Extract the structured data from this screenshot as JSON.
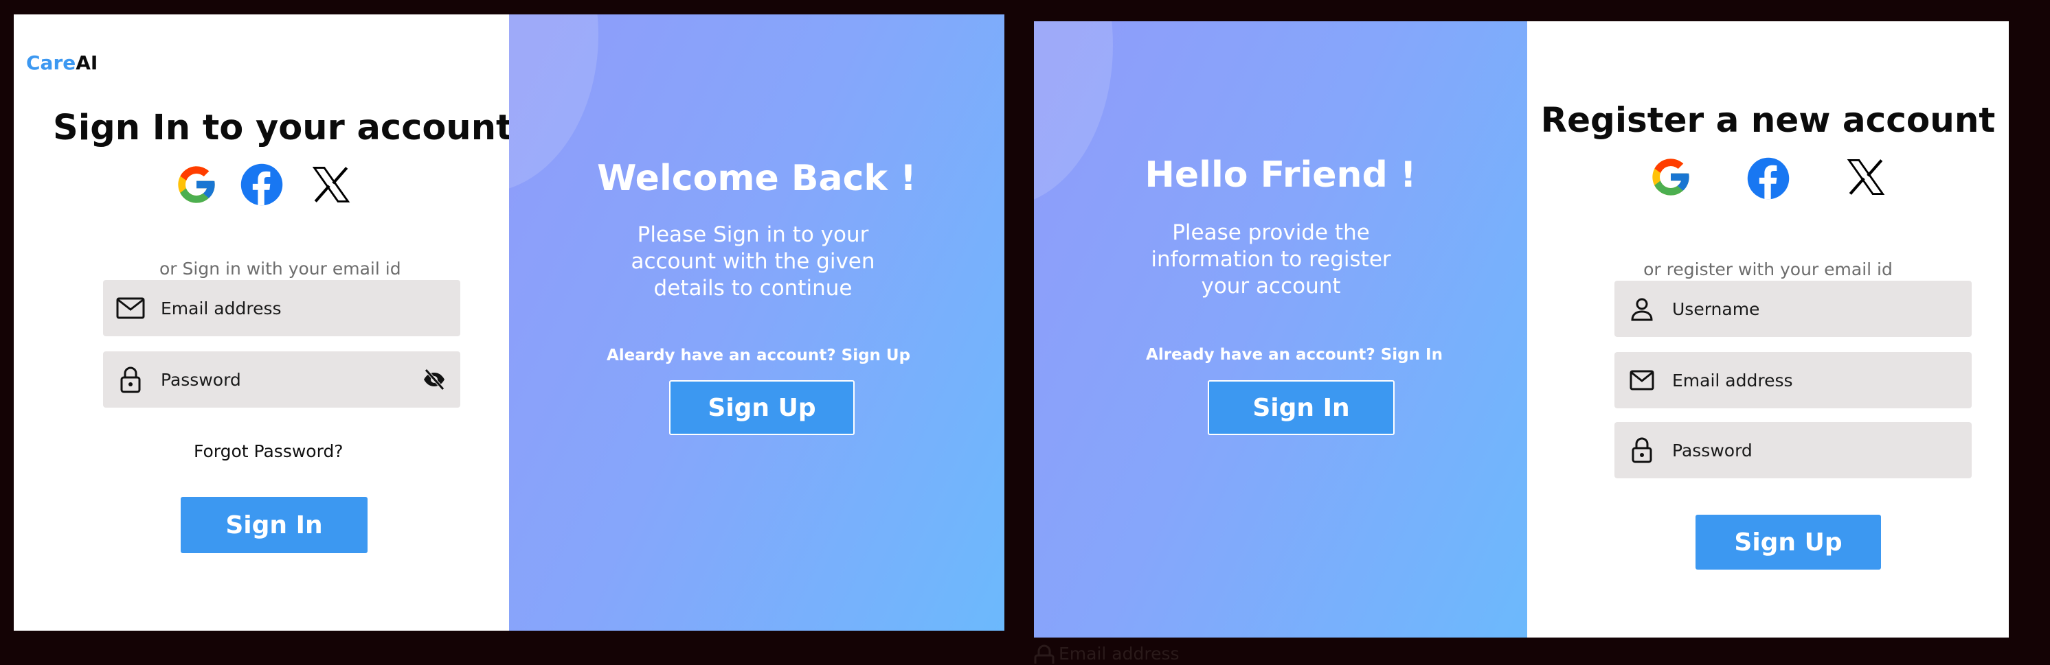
{
  "colors": {
    "background": "#140305",
    "brand_blue": "#3c98f1",
    "field_bg": "#e7e4e4",
    "gradient_start": "#8f9cf9",
    "gradient_end": "#6cb9fc"
  },
  "signin_form": {
    "logo_part1": "Care",
    "logo_part2": "AI",
    "title": "Sign In to your account",
    "social_icons": [
      "google-icon",
      "facebook-icon",
      "x-icon"
    ],
    "divider_text": "or Sign in with your email id",
    "email_placeholder": "Email address",
    "password_placeholder": "Password",
    "forgot_password": "Forgot Password?",
    "submit_label": "Sign In"
  },
  "welcome_panel": {
    "title": "Welcome Back !",
    "body_line1": "Please Sign in to your",
    "body_line2": "account with the given",
    "body_line3": "details to continue",
    "prompt": "Aleardy have an account? Sign Up",
    "button_label": "Sign Up"
  },
  "hello_panel": {
    "title": "Hello Friend !",
    "body_line1": "Please provide the",
    "body_line2": "information to register",
    "body_line3": "your account",
    "prompt": "Already have an account? Sign In",
    "button_label": "Sign In"
  },
  "register_form": {
    "title": "Register a new account",
    "social_icons": [
      "google-icon",
      "facebook-icon",
      "x-icon"
    ],
    "divider_text": "or register with your email id",
    "username_placeholder": "Username",
    "email_placeholder": "Email address",
    "password_placeholder": "Password",
    "submit_label": "Sign Up"
  },
  "overflow_text": "Email address"
}
